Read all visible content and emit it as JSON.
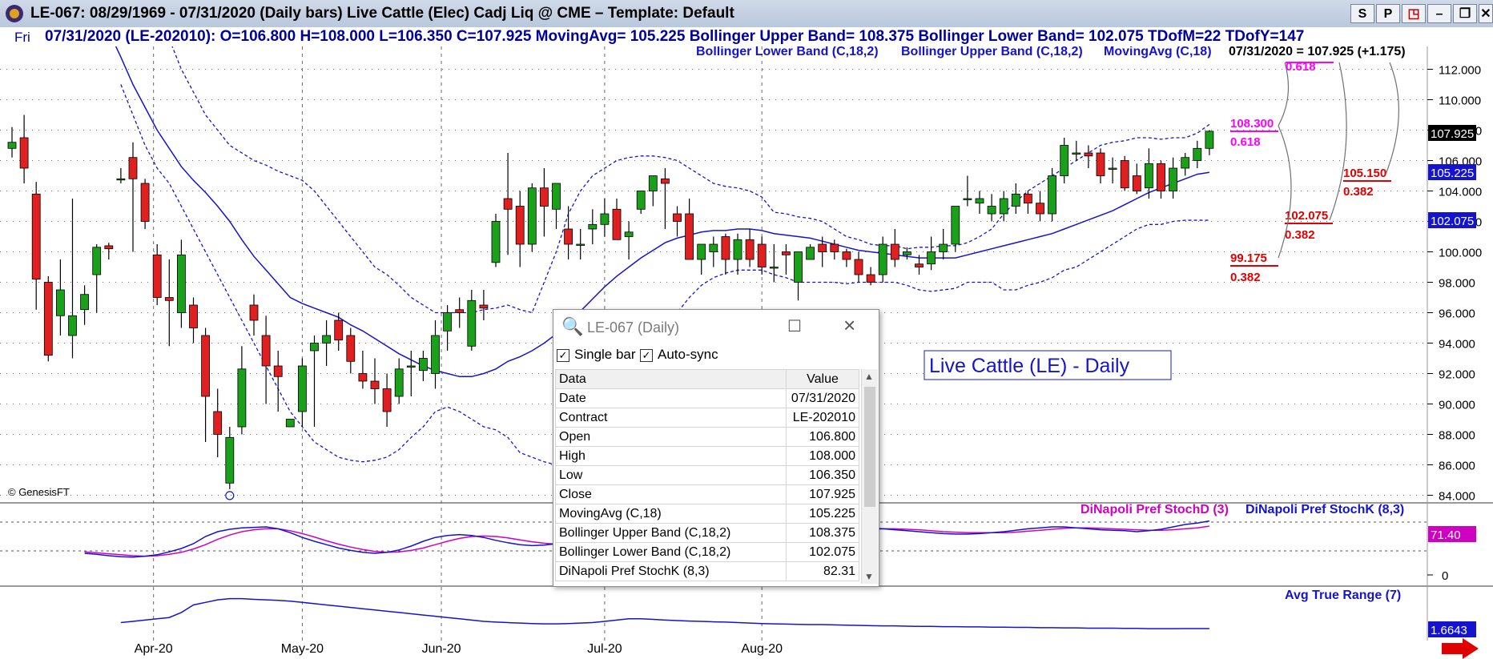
{
  "window": {
    "title": "LE-067:  08/29/1969 - 07/31/2020  (Daily bars)   Live Cattle (Elec) Cadj Liq @ CME  –  Template: Default",
    "buttons": [
      "S",
      "P",
      "◳",
      "–",
      "❐",
      "✕"
    ]
  },
  "infobar": {
    "day": "Fri",
    "text": "07/31/2020 (LE-202010):  O=106.800  H=108.000  L=106.350  C=107.925  MovingAvg= 105.225  Bollinger Upper Band= 108.375  Bollinger Lower Band= 102.075  TDofM=22  TDofY=147"
  },
  "legend": {
    "lower_band": "Bollinger Lower Band (C,18,2)",
    "upper_band": "Bollinger Upper Band (C,18,2)",
    "moving_avg": "MovingAvg (C,18)",
    "last_quote": "07/31/2020 = 107.925 (+1.175)"
  },
  "price_chart_title": "Live Cattle (LE) - Daily",
  "copyright": "© GenesisFT",
  "stoch_legend": {
    "d": "DiNapoli Pref StochD (3)",
    "k": "DiNapoli Pref StochK (8,3)"
  },
  "atr_legend": "Avg True Range (7)",
  "colors": {
    "up_candle": "#1aa01a",
    "down_candle": "#e02020",
    "band": "#1414d0",
    "fib_magenta": "#ff00ff",
    "fib_red": "#e00000",
    "stoch_k": "#1414d0",
    "stoch_d": "#d000c0",
    "grid": "#6a6a6a"
  },
  "fib_labels": [
    {
      "price": "108.300",
      "ratio": "0.618",
      "color": "magenta"
    },
    {
      "price": "",
      "ratio": "0.618",
      "color": "magenta"
    },
    {
      "price": "105.150",
      "ratio": "0.382",
      "color": "red"
    },
    {
      "price": "102.075",
      "ratio": "0.382",
      "color": "red"
    },
    {
      "price": "99.175",
      "ratio": "0.382",
      "color": "red"
    }
  ],
  "right_axis_tags": [
    {
      "value": "107.925",
      "bg": "#000000"
    },
    {
      "value": "105.225",
      "bg": "#1414d0"
    },
    {
      "value": "102.075",
      "bg": "#1414d0"
    },
    {
      "value": "71.40",
      "bg": "#d000c0"
    },
    {
      "value": "1.6643",
      "bg": "#1414d0"
    }
  ],
  "stoch_axis_label": "0",
  "popup": {
    "title": "LE-067 (Daily)",
    "single_bar": "Single bar",
    "auto_sync": "Auto-sync",
    "col_data": "Data",
    "col_value": "Value",
    "rows": [
      [
        "Date",
        "07/31/2020"
      ],
      [
        "Contract",
        "LE-202010"
      ],
      [
        "Open",
        "106.800"
      ],
      [
        "High",
        "108.000"
      ],
      [
        "Low",
        "106.350"
      ],
      [
        "Close",
        "107.925"
      ],
      [
        "MovingAvg (C,18)",
        "105.225"
      ],
      [
        "Bollinger Upper Band (C,18,2)",
        "108.375"
      ],
      [
        "Bollinger Lower Band (C,18,2)",
        "102.075"
      ],
      [
        "DiNapoli Pref StochK (8,3)",
        "82.31"
      ]
    ]
  },
  "chart_data": {
    "type": "candlestick",
    "y_ticks": [
      84,
      86,
      88,
      90,
      92,
      94,
      96,
      98,
      100,
      102,
      104,
      106,
      108,
      110,
      112
    ],
    "y_tick_labels": [
      "84.000",
      "86.000",
      "88.000",
      "90.000",
      "92.000",
      "94.000",
      "96.000",
      "98.000",
      "100.000",
      "102.000",
      "104.000",
      "106.000",
      "108.000",
      "110.000",
      "112.000"
    ],
    "ylim": [
      83.5,
      113.5
    ],
    "x_labels": [
      "Apr-20",
      "May-20",
      "Jun-20",
      "Jul-20",
      "Aug-20"
    ],
    "x_label_bar_index": [
      11.7,
      24,
      35.5,
      49,
      62
    ],
    "candles": [
      [
        106.8,
        108.2,
        106.2,
        107.2
      ],
      [
        107.5,
        109.0,
        104.5,
        105.5
      ],
      [
        103.8,
        104.6,
        96.2,
        98.2
      ],
      [
        98.0,
        98.4,
        92.8,
        93.2
      ],
      [
        95.8,
        99.5,
        94.5,
        97.5
      ],
      [
        94.5,
        103.5,
        93.0,
        95.8
      ],
      [
        96.2,
        97.8,
        95.2,
        97.2
      ],
      [
        98.5,
        100.5,
        96.0,
        100.3
      ],
      [
        100.4,
        100.6,
        99.5,
        100.2
      ],
      [
        104.8,
        105.5,
        104.5,
        104.8
      ],
      [
        106.2,
        107.2,
        100.0,
        104.8
      ],
      [
        104.5,
        104.8,
        101.5,
        102.0
      ],
      [
        99.8,
        100.5,
        96.5,
        97.0
      ],
      [
        97.0,
        99.5,
        93.8,
        96.8
      ],
      [
        96.0,
        100.8,
        95.0,
        99.8
      ],
      [
        96.5,
        97.0,
        94.0,
        95.0
      ],
      [
        94.5,
        95.0,
        87.5,
        90.5
      ],
      [
        89.5,
        91.0,
        86.5,
        88.0
      ],
      [
        84.8,
        88.5,
        84.4,
        87.8
      ],
      [
        88.5,
        93.8,
        88.0,
        92.3
      ],
      [
        96.5,
        97.2,
        94.5,
        95.5
      ],
      [
        94.5,
        95.8,
        90.0,
        92.5
      ],
      [
        92.5,
        93.5,
        89.5,
        91.8
      ],
      [
        88.5,
        89.0,
        88.5,
        89.0
      ],
      [
        89.5,
        93.0,
        88.5,
        92.5
      ],
      [
        93.5,
        94.5,
        88.5,
        94.0
      ],
      [
        94.0,
        95.5,
        92.5,
        94.5
      ],
      [
        95.5,
        96.0,
        93.5,
        94.2
      ],
      [
        94.5,
        95.0,
        92.0,
        92.8
      ],
      [
        92.0,
        93.5,
        91.0,
        91.5
      ],
      [
        91.5,
        93.0,
        90.0,
        91.0
      ],
      [
        91.0,
        92.0,
        88.5,
        89.5
      ],
      [
        90.5,
        93.0,
        90.0,
        92.3
      ],
      [
        92.5,
        93.5,
        90.5,
        92.5
      ],
      [
        92.2,
        93.5,
        91.5,
        93.0
      ],
      [
        92.0,
        95.5,
        91.0,
        94.5
      ],
      [
        94.8,
        96.5,
        93.5,
        96.0
      ],
      [
        96.2,
        97.0,
        95.0,
        96.0
      ],
      [
        93.8,
        97.5,
        93.5,
        96.8
      ],
      [
        96.5,
        97.5,
        95.5,
        96.3
      ],
      [
        99.3,
        102.5,
        99.0,
        102.0
      ],
      [
        103.5,
        106.5,
        99.8,
        102.8
      ],
      [
        103.0,
        104.0,
        99.0,
        100.5
      ],
      [
        100.5,
        104.5,
        100.0,
        104.2
      ],
      [
        104.2,
        105.5,
        101.0,
        103.0
      ],
      [
        102.8,
        104.5,
        101.5,
        104.5
      ],
      [
        101.5,
        103.0,
        99.5,
        100.5
      ],
      [
        100.5,
        101.5,
        99.5,
        100.5
      ],
      [
        101.5,
        102.8,
        100.5,
        101.8
      ],
      [
        101.8,
        103.5,
        101.0,
        102.5
      ],
      [
        102.8,
        103.5,
        101.5,
        100.8
      ],
      [
        101.0,
        102.0,
        99.5,
        101.3
      ],
      [
        102.8,
        104.0,
        102.5,
        104.0
      ],
      [
        104.0,
        105.0,
        103.0,
        105.0
      ],
      [
        104.8,
        105.5,
        101.5,
        104.5
      ],
      [
        102.5,
        103.0,
        101.0,
        102.0
      ],
      [
        102.5,
        103.5,
        99.5,
        99.5
      ],
      [
        99.5,
        100.5,
        98.5,
        100.5
      ],
      [
        100.0,
        101.0,
        99.0,
        100.5
      ],
      [
        101.0,
        101.2,
        98.5,
        99.5
      ],
      [
        99.5,
        101.2,
        98.5,
        100.8
      ],
      [
        100.8,
        101.5,
        99.0,
        99.5
      ],
      [
        100.5,
        101.0,
        98.5,
        99.0
      ],
      [
        99.0,
        100.5,
        98.0,
        99.0
      ],
      [
        100.0,
        100.5,
        98.5,
        99.8
      ],
      [
        98.0,
        99.3,
        96.8,
        100.0
      ],
      [
        99.5,
        100.5,
        99.5,
        100.3
      ],
      [
        100.5,
        101.0,
        99.0,
        100.0
      ],
      [
        100.5,
        100.8,
        99.5,
        100.0
      ],
      [
        100.0,
        100.2,
        99.0,
        99.5
      ],
      [
        99.5,
        100.0,
        98.0,
        98.5
      ],
      [
        98.5,
        99.0,
        97.8,
        98.0
      ],
      [
        98.5,
        101.0,
        98.0,
        100.5
      ],
      [
        100.5,
        101.5,
        99.0,
        99.5
      ],
      [
        99.8,
        100.3,
        99.5,
        100.0
      ],
      [
        99.2,
        99.8,
        98.5,
        99.0
      ],
      [
        99.2,
        101.0,
        98.8,
        100.0
      ],
      [
        100.0,
        101.5,
        99.5,
        100.5
      ],
      [
        100.5,
        103.0,
        100.0,
        103.0
      ],
      [
        103.5,
        105.0,
        103.0,
        103.5
      ],
      [
        103.2,
        104.0,
        102.5,
        103.5
      ],
      [
        102.5,
        103.8,
        102.0,
        103.0
      ],
      [
        102.5,
        104.0,
        102.0,
        103.5
      ],
      [
        103.0,
        104.5,
        102.5,
        103.8
      ],
      [
        103.8,
        104.0,
        102.5,
        103.2
      ],
      [
        103.2,
        104.0,
        102.0,
        102.5
      ],
      [
        102.5,
        105.5,
        102.0,
        105.0
      ],
      [
        105.0,
        107.5,
        104.5,
        107.0
      ],
      [
        106.5,
        107.3,
        106.0,
        106.5
      ],
      [
        106.5,
        107.0,
        105.5,
        106.3
      ],
      [
        106.5,
        106.8,
        104.5,
        105.0
      ],
      [
        105.5,
        106.2,
        104.5,
        105.5
      ],
      [
        106.0,
        106.3,
        104.0,
        104.2
      ],
      [
        105.0,
        105.8,
        103.8,
        104.0
      ],
      [
        104.2,
        106.8,
        103.5,
        105.8
      ],
      [
        105.8,
        106.0,
        103.5,
        104.0
      ],
      [
        104.0,
        106.2,
        103.5,
        105.5
      ],
      [
        105.5,
        106.5,
        105.0,
        106.2
      ],
      [
        106.0,
        107.3,
        105.5,
        106.8
      ],
      [
        106.8,
        108.0,
        106.35,
        107.925
      ]
    ],
    "moving_avg": [
      114.5,
      112.8,
      111.0,
      109.5,
      108.0,
      106.8,
      105.6,
      104.7,
      103.9,
      103.0,
      102.0,
      100.8,
      99.7,
      98.8,
      97.9,
      97.0,
      96.6,
      96.3,
      96.0,
      95.7,
      95.2,
      94.8,
      94.3,
      93.8,
      93.3,
      92.9,
      92.5,
      92.2,
      92.0,
      91.8,
      91.8,
      92.0,
      92.3,
      92.8,
      93.1,
      93.5,
      94.0,
      94.6,
      95.3,
      96.1,
      96.9,
      97.7,
      98.4,
      99.0,
      99.6,
      100.1,
      100.6,
      100.9,
      101.1,
      101.3,
      101.4,
      101.4,
      101.5,
      101.5,
      101.4,
      101.2,
      101.1,
      101.0,
      100.9,
      100.7,
      100.5,
      100.3,
      100.1,
      100.0,
      99.9,
      99.8,
      99.7,
      99.6,
      99.6,
      99.6,
      99.6,
      99.8,
      100.0,
      100.2,
      100.4,
      100.6,
      100.8,
      101.0,
      101.2,
      101.5,
      101.8,
      102.1,
      102.4,
      102.7,
      103.1,
      103.5,
      103.9,
      104.2,
      104.5,
      104.8,
      105.1,
      105.225
    ],
    "upper_band": [
      118.0,
      117.0,
      116.0,
      115.0,
      114.0,
      112.0,
      110.5,
      109.0,
      108.0,
      107.0,
      106.5,
      106.0,
      105.7,
      105.3,
      105.0,
      104.7,
      104.0,
      103.0,
      102.0,
      101.0,
      100.0,
      99.0,
      98.5,
      97.8,
      97.0,
      96.5,
      96.0,
      96.0,
      96.0,
      96.0,
      96.2,
      96.3,
      96.5,
      96.2,
      96.0,
      98.0,
      100.0,
      102.5,
      104.0,
      105.0,
      105.5,
      106.0,
      106.2,
      106.3,
      106.3,
      106.2,
      106.0,
      105.5,
      105.0,
      104.5,
      104.3,
      104.2,
      104.0,
      103.6,
      102.6,
      102.5,
      102.3,
      102.2,
      102.0,
      101.5,
      101.0,
      100.8,
      100.5,
      100.4,
      100.4,
      100.2,
      100.3,
      100.3,
      100.4,
      100.4,
      100.6,
      101.0,
      101.5,
      102.5,
      103.3,
      104.0,
      104.5,
      105.0,
      105.5,
      106.0,
      106.5,
      107.0,
      107.2,
      107.3,
      107.5,
      107.5,
      107.4,
      107.5,
      107.5,
      107.8,
      108.375
    ],
    "lower_band": [
      111.0,
      109.0,
      107.0,
      105.5,
      104.5,
      103.0,
      101.5,
      100.0,
      98.5,
      97.0,
      95.5,
      94.0,
      92.5,
      91.0,
      89.5,
      88.5,
      87.5,
      87.0,
      86.5,
      86.3,
      86.2,
      86.3,
      86.5,
      87.0,
      87.8,
      88.5,
      89.5,
      89.8,
      89.5,
      89.0,
      88.5,
      88.3,
      87.8,
      86.8,
      86.5,
      86.2,
      86.0,
      86.0,
      86.2,
      86.8,
      87.8,
      89.2,
      90.8,
      92.2,
      93.5,
      94.8,
      96.0,
      97.0,
      97.8,
      98.3,
      98.6,
      98.8,
      98.8,
      98.8,
      98.5,
      98.3,
      98.0,
      98.0,
      98.0,
      98.0,
      97.9,
      98.0,
      98.0,
      98.0,
      98.0,
      97.8,
      97.5,
      97.4,
      97.5,
      97.6,
      98.0,
      98.0,
      98.0,
      97.5,
      97.5,
      97.8,
      98.0,
      98.3,
      98.8,
      99.0,
      99.5,
      100.0,
      100.5,
      101.0,
      101.5,
      101.8,
      101.8,
      102.0,
      102.075,
      102.075,
      102.075
    ],
    "stoch_k": [
      15,
      13,
      10,
      8,
      7,
      9,
      12,
      18,
      25,
      35,
      50,
      60,
      65,
      68,
      69,
      70,
      66,
      58,
      48,
      40,
      33,
      26,
      21,
      17,
      15,
      17,
      22,
      30,
      40,
      48,
      52,
      54,
      52,
      48,
      42,
      37,
      33,
      31,
      32,
      35,
      42,
      52,
      60,
      66,
      70,
      72,
      70,
      67,
      64,
      60,
      58,
      55,
      53,
      50,
      48,
      48,
      47,
      46,
      47,
      49,
      51,
      56,
      62,
      66,
      68,
      68,
      66,
      64,
      62,
      60,
      58,
      56,
      55,
      55,
      56,
      58,
      60,
      63,
      66,
      68,
      70,
      70,
      68,
      66,
      64,
      63,
      62,
      60,
      62,
      65,
      70,
      75,
      78,
      82.31
    ],
    "stoch_d": [
      18,
      16,
      14,
      12,
      10,
      9,
      10,
      13,
      17,
      24,
      33,
      44,
      53,
      60,
      64,
      66,
      66,
      62,
      56,
      49,
      41,
      34,
      28,
      23,
      19,
      17,
      18,
      21,
      26,
      33,
      40,
      46,
      50,
      51,
      50,
      47,
      43,
      39,
      36,
      34,
      35,
      39,
      45,
      52,
      58,
      63,
      66,
      67,
      66,
      64,
      62,
      59,
      57,
      55,
      53,
      51,
      50,
      48,
      47,
      47,
      48,
      50,
      53,
      57,
      61,
      64,
      66,
      66,
      65,
      64,
      62,
      60,
      59,
      58,
      58,
      58,
      58,
      59,
      61,
      63,
      65,
      67,
      68,
      68,
      67,
      66,
      65,
      64,
      63,
      63,
      64,
      66,
      68,
      71.4
    ],
    "atr": [
      1.9,
      1.95,
      2.0,
      2.05,
      2.1,
      2.3,
      2.6,
      2.7,
      2.8,
      2.85,
      2.85,
      2.82,
      2.8,
      2.78,
      2.75,
      2.7,
      2.65,
      2.6,
      2.55,
      2.5,
      2.45,
      2.4,
      2.35,
      2.3,
      2.25,
      2.2,
      2.15,
      2.1,
      2.05,
      2.0,
      1.95,
      1.92,
      1.9,
      1.88,
      1.86,
      1.85,
      1.85,
      1.86,
      1.88,
      1.9,
      1.95,
      2.0,
      2.05,
      2.05,
      2.03,
      2.0,
      1.98,
      1.96,
      1.95,
      1.93,
      1.92,
      1.9,
      1.88,
      1.86,
      1.85,
      1.84,
      1.83,
      1.82,
      1.82,
      1.81,
      1.8,
      1.79,
      1.78,
      1.77,
      1.77,
      1.76,
      1.75,
      1.75,
      1.74,
      1.74,
      1.73,
      1.73,
      1.72,
      1.72,
      1.71,
      1.71,
      1.7,
      1.7,
      1.69,
      1.69,
      1.68,
      1.68,
      1.68,
      1.67,
      1.67,
      1.66,
      1.66,
      1.66,
      1.665,
      1.665,
      1.6643
    ]
  }
}
